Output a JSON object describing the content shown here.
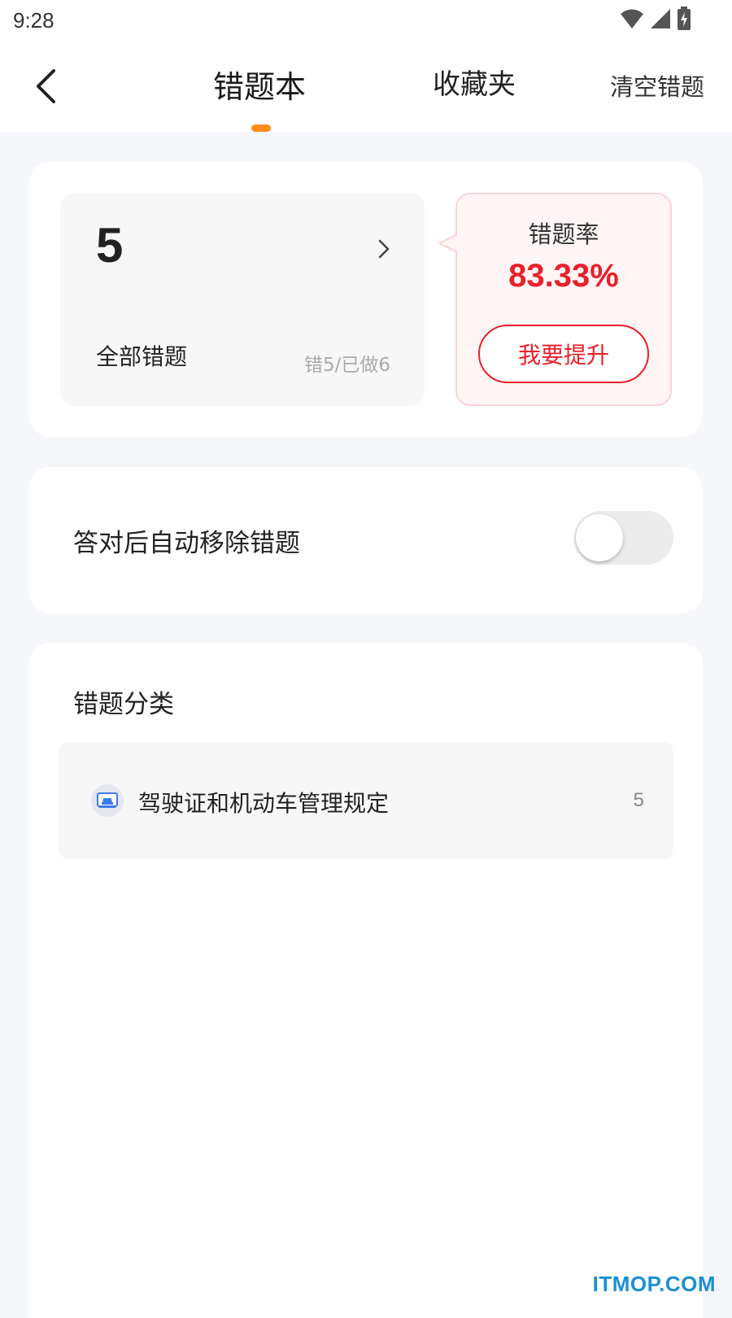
{
  "status_bar": {
    "time": "9:28",
    "icons": [
      "wifi-icon",
      "signal-icon",
      "battery-charging-icon"
    ]
  },
  "nav": {
    "tabs": [
      {
        "label": "错题本",
        "active": true
      },
      {
        "label": "收藏夹",
        "active": false
      }
    ],
    "clear_label": "清空错题",
    "accent_color": "#ff8c1a"
  },
  "summary": {
    "total_count": "5",
    "all_label": "全部错题",
    "ratio_text": "错5/已做6",
    "rate_label": "错题率",
    "rate_value": "83.33%",
    "improve_label": "我要提升",
    "rate_color": "#e8202a"
  },
  "settings": {
    "auto_remove_label": "答对后自动移除错题",
    "auto_remove_enabled": false
  },
  "categories": {
    "title": "错题分类",
    "items": [
      {
        "name": "驾驶证和机动车管理规定",
        "count": "5",
        "icon": "car-card-icon"
      }
    ]
  },
  "watermark": "ITMOP.COM"
}
